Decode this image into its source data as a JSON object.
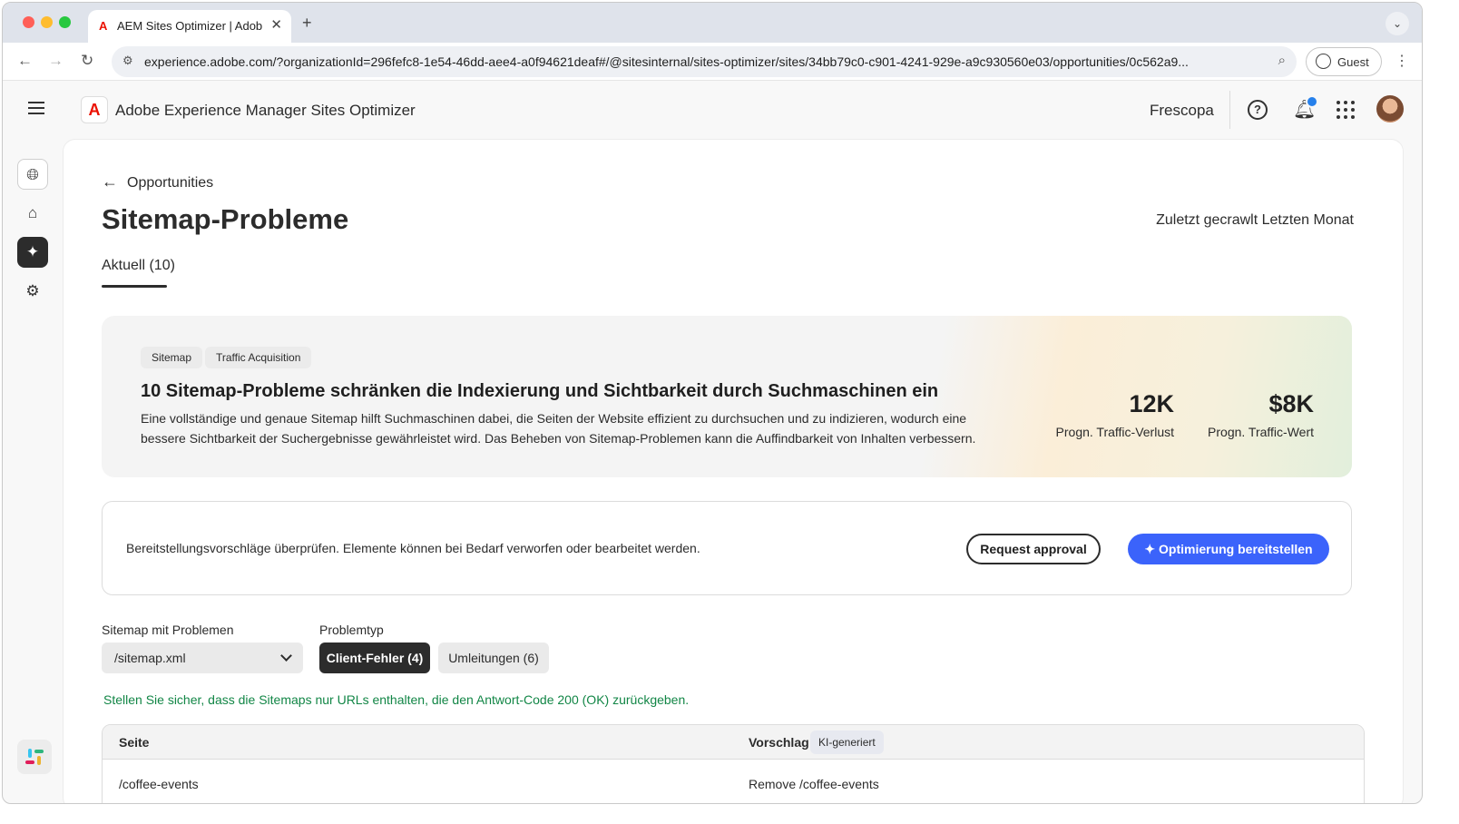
{
  "browser": {
    "tab_title": "AEM Sites Optimizer | Adobe",
    "url": "experience.adobe.com/?organizationId=296fefc8-1e54-46dd-aee4-a0f94621deaf#/@sitesinternal/sites-optimizer/sites/34bb79c0-c901-4241-929e-a9c930560e03/opportunities/0c562a9...",
    "guest_label": "Guest"
  },
  "header": {
    "app_title": "Adobe Experience Manager Sites Optimizer",
    "org_name": "Frescopa"
  },
  "page": {
    "back_label": "Opportunities",
    "title": "Sitemap-Probleme",
    "last_crawled": "Zuletzt gecrawlt Letzten Monat",
    "tab_current": "Aktuell (10)"
  },
  "hero": {
    "tags": [
      "Sitemap",
      "Traffic Acquisition"
    ],
    "heading": "10 Sitemap-Probleme schränken die Indexierung und Sichtbarkeit durch Suchmaschinen ein",
    "description": "Eine vollständige und genaue Sitemap hilft Suchmaschinen dabei, die Seiten der Website effizient zu durchsuchen und zu indizieren, wodurch eine bessere Sichtbarkeit der Suchergebnisse gewährleistet wird. Das Beheben von Sitemap-Problemen kann die Auffindbarkeit von Inhalten verbessern.",
    "metrics": [
      {
        "value": "12K",
        "label": "Progn. Traffic-Verlust"
      },
      {
        "value": "$8K",
        "label": "Progn. Traffic-Wert"
      }
    ]
  },
  "actions": {
    "text": "Bereitstellungsvorschläge überprüfen. Elemente können bei Bedarf verworfen oder bearbeitet werden.",
    "request_label": "Request approval",
    "deploy_label": "Optimierung bereitstellen"
  },
  "filters": {
    "sitemap_label": "Sitemap mit Problemen",
    "sitemap_value": "/sitemap.xml",
    "type_label": "Problemtyp",
    "type_options": [
      "Client-Fehler (4)",
      "Umleitungen (6)"
    ],
    "hint": "Stellen Sie sicher, dass die Sitemaps nur URLs enthalten, die den Antwort-Code 200 (OK) zurückgeben."
  },
  "table": {
    "headers": {
      "page": "Seite",
      "suggestion": "Vorschlag",
      "ai_badge": "KI-generiert"
    },
    "rows": [
      {
        "page": "/coffee-events",
        "suggestion": "Remove /coffee-events"
      }
    ]
  },
  "colors": {
    "accent": "#3b63fb",
    "hint_green": "#128646",
    "adobe_red": "#eb1000"
  }
}
